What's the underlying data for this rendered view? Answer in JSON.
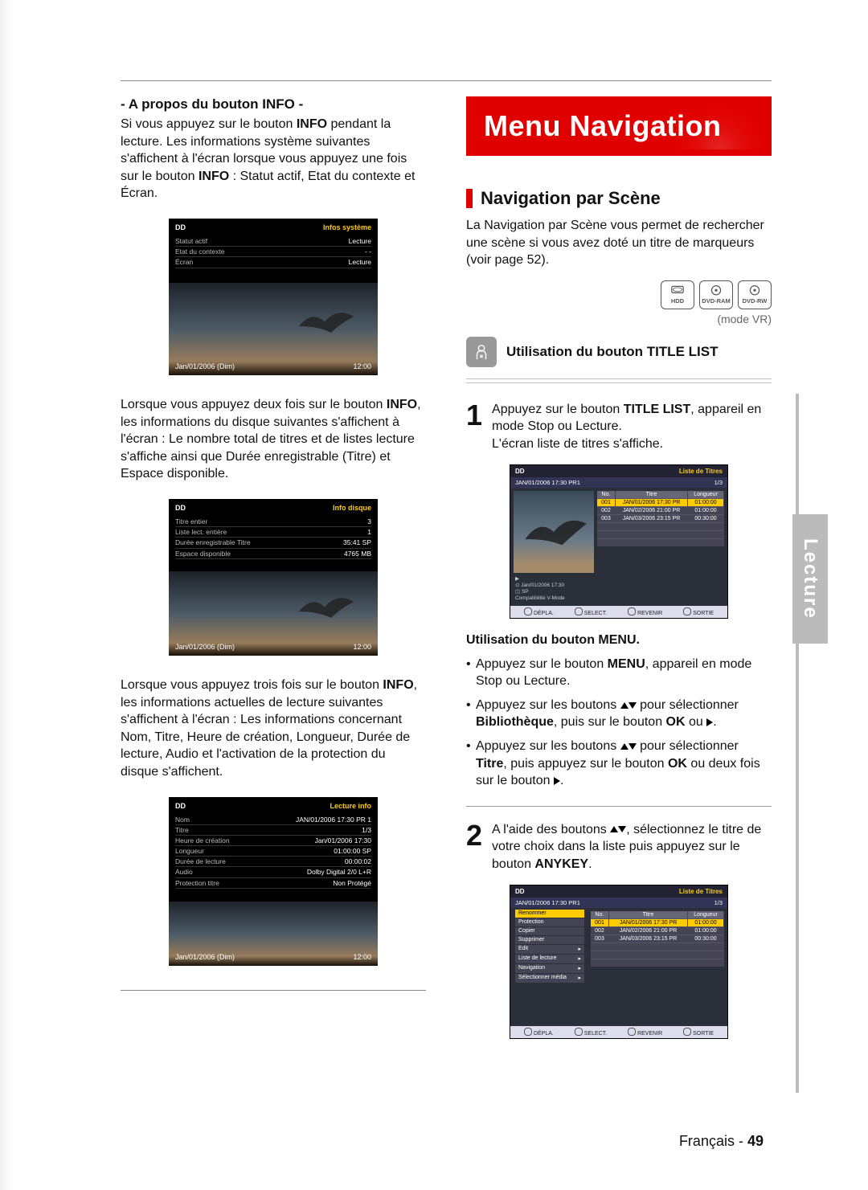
{
  "left": {
    "info_heading": "- A propos du bouton INFO -",
    "p1a": "Si vous appuyez sur le bouton ",
    "p1b": "INFO",
    "p1c": " pendant la lecture. Les informations système suivantes s'affichent à l'écran lorsque vous appuyez une fois sur le bouton ",
    "p1d": "INFO",
    "p1e": " : Statut actif, Etat du contexte et Écran.",
    "p2a": "Lorsque vous appuyez deux fois sur le bouton ",
    "p2b": "INFO",
    "p2c": ", les informations du disque suivantes s'affichent à l'écran : Le nombre total de titres et de listes lecture s'affiche ainsi que Durée enregistrable (Titre) et Espace disponible.",
    "p3a": "Lorsque vous appuyez trois fois sur le bouton ",
    "p3b": "INFO",
    "p3c": ", les informations actuelles de lecture suivantes s'affichent à l'écran : Les informations concernant Nom, Titre, Heure de création, Longueur, Durée de lecture, Audio et l'activation de la protection du disque s'affichent.",
    "tv1": {
      "tl": "DD",
      "tr": "Infos système",
      "rows": [
        {
          "l": "Statut actif",
          "r": "Lecture"
        },
        {
          "l": "Etat du contexte",
          "r": "- -"
        },
        {
          "l": "Écran",
          "r": "Lecture"
        }
      ],
      "bl": "Jan/01/2006 (Dim)",
      "br": "12:00"
    },
    "tv2": {
      "tl": "DD",
      "tr": "Info disque",
      "rows": [
        {
          "l": "Titre entier",
          "r": "3"
        },
        {
          "l": "Liste lect. entière",
          "r": "1"
        },
        {
          "l": "Durée enregistrable Titre",
          "r": "35:41  SP"
        },
        {
          "l": "Espace disponible",
          "r": "4765 MB"
        }
      ],
      "bl": "Jan/01/2006 (Dim)",
      "br": "12:00"
    },
    "tv3": {
      "tl": "DD",
      "tr": "Lecture info",
      "rows": [
        {
          "l": "Nom",
          "r": "JAN/01/2006 17:30 PR 1"
        },
        {
          "l": "Titre",
          "r": "1/3"
        },
        {
          "l": "Heure de création",
          "r": "Jan/01/2006 17:30"
        },
        {
          "l": "Longueur",
          "r": "01:00:00 SP"
        },
        {
          "l": "Durée de lecture",
          "r": "00:00:02"
        },
        {
          "l": "Audio",
          "r": "Dolby Digital 2/0 L+R"
        },
        {
          "l": "Protection titre",
          "r": "Non Protégé"
        }
      ],
      "bl": "Jan/01/2006 (Dim)",
      "br": "12:00"
    }
  },
  "right": {
    "menu_header": "Menu Navigation",
    "sec_title": "Navigation par Scène",
    "intro": "La Navigation par Scène vous permet de rechercher une scène si vous avez doté un titre de marqueurs (voir page 52).",
    "discs": {
      "a": "HDD",
      "b": "DVD-RAM",
      "c": "DVD-RW"
    },
    "mode_vr": "(mode VR)",
    "subtitle": "Utilisation du bouton TITLE LIST",
    "step1a": "Appuyez sur le bouton ",
    "step1b": "TITLE LIST",
    "step1c": ", appareil en mode Stop ou Lecture.",
    "step1d": "L'écran liste de titres s'affiche.",
    "list_hdr_l": "DD",
    "list_hdr_r": "Liste de Titres",
    "list_sub_l": "JAN/01/2006 17:30 PR1",
    "list_sub_r": "1/3",
    "list_th": {
      "no": "No.",
      "titre": "Titre",
      "longueur": "Longueur"
    },
    "list_rows": [
      {
        "no": "001",
        "titre": "JAN/01/2006 17:30 PR",
        "len": "01:00:00"
      },
      {
        "no": "002",
        "titre": "JAN/02/2006 21:00 PR",
        "len": "01:00:00"
      },
      {
        "no": "003",
        "titre": "JAN/03/2006 23:15 PR",
        "len": "00:30:00"
      }
    ],
    "list_info1": "Jan/01/2006 17:30",
    "list_info2": "SP",
    "list_info3": "Compatibilité V-Mode",
    "list_footer": {
      "a": "DÉPLA.",
      "b": "SELECT.",
      "c": "REVENIR",
      "d": "SORTIE"
    },
    "menu_subtitle": "Utilisation du bouton MENU.",
    "b1a": "Appuyez sur le bouton ",
    "b1b": "MENU",
    "b1c": ", appareil en mode Stop ou Lecture.",
    "b2a": "Appuyez sur les boutons ",
    "b2b": " pour sélectionner ",
    "b2c": "Bibliothèque",
    "b2d": ", puis sur le bouton ",
    "b2e": "OK",
    "b2f": " ou ",
    "b3a": "Appuyez sur les boutons ",
    "b3b": " pour sélectionner ",
    "b3c": "Titre",
    "b3d": ", puis appuyez sur le bouton ",
    "b3e": "OK",
    "b3f": " ou deux fois sur le bouton ",
    "step2a": "A l'aide des boutons ",
    "step2b": ", sélectionnez le titre de votre choix dans la liste puis appuyez sur le bouton ",
    "step2c": "ANYKEY",
    "step2d": ".",
    "ctx_menu": [
      "Renommer",
      "Protection",
      "Copier",
      "Supprimer",
      "Edit",
      "Liste de lecture",
      "Navigation",
      "Sélectionner média"
    ],
    "side_tab": "Lecture",
    "page_lang": "Français - ",
    "page_num": "49"
  }
}
